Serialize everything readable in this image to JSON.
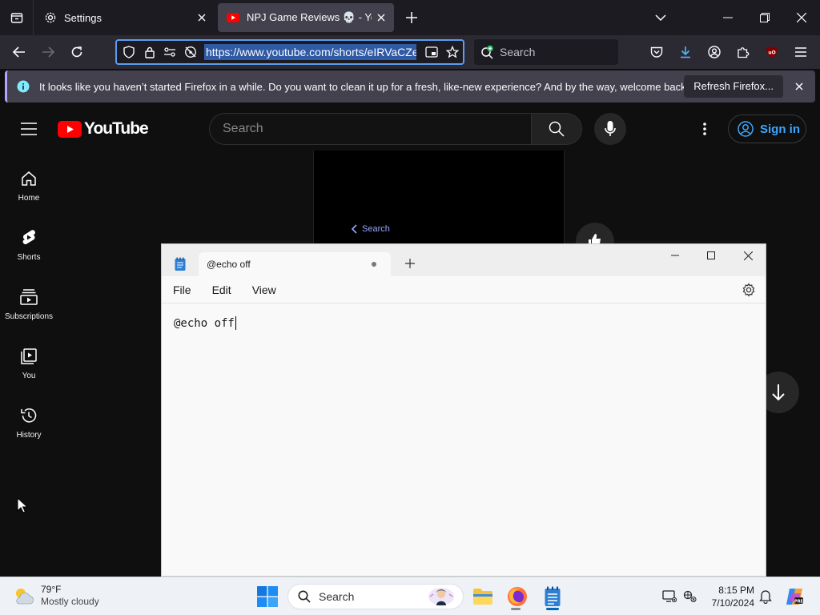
{
  "browser": {
    "tabs": [
      {
        "label": "Settings",
        "favicon": "gear-icon"
      },
      {
        "label": "NPJ Game Reviews 💀 - YouTube",
        "favicon": "youtube-icon"
      }
    ],
    "url": "https://www.youtube.com/shorts/eIRVaCZe_",
    "search_placeholder": "Search",
    "notification": {
      "message": "It looks like you haven’t started Firefox in a while. Do you want to clean it up for a fresh, like-new experience? And by the way, welcome back!",
      "button_label": "Refresh Firefox..."
    }
  },
  "youtube": {
    "wordmark": "YouTube",
    "search_placeholder": "Search",
    "signin_label": "Sign in",
    "nav": [
      {
        "label": "Home",
        "icon": "home-icon"
      },
      {
        "label": "Shorts",
        "icon": "shorts-icon"
      },
      {
        "label": "Subscriptions",
        "icon": "subscriptions-icon"
      },
      {
        "label": "You",
        "icon": "you-icon"
      },
      {
        "label": "History",
        "icon": "history-icon"
      }
    ],
    "short_back_label": "Search"
  },
  "notepad": {
    "tab_title": "@echo off",
    "menus": [
      "File",
      "Edit",
      "View"
    ],
    "content": "@echo off"
  },
  "taskbar": {
    "temperature": "79°F",
    "condition": "Mostly cloudy",
    "search_placeholder": "Search",
    "time": "8:15 PM",
    "date": "7/10/2024"
  },
  "colors": {
    "firefox_frame": "#1c1b22",
    "firefox_toolbar": "#2b2a33",
    "url_focus": "#5b9cf2",
    "youtube_red": "#ff0000",
    "youtube_link": "#3ea6ff",
    "taskbar": "#eef1f5"
  }
}
